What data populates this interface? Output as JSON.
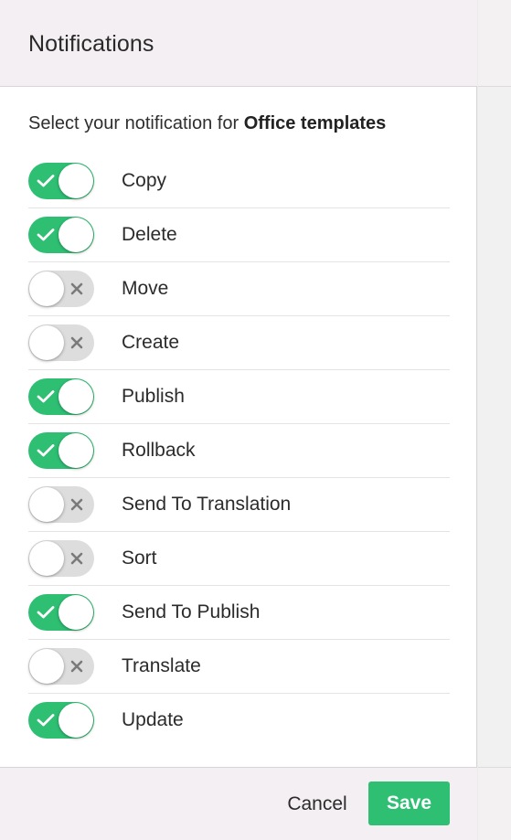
{
  "dialog": {
    "title": "Notifications",
    "subtitle_prefix": "Select your notification for ",
    "subtitle_target": "Office templates"
  },
  "options": [
    {
      "label": "Copy",
      "enabled": true
    },
    {
      "label": "Delete",
      "enabled": true
    },
    {
      "label": "Move",
      "enabled": false
    },
    {
      "label": "Create",
      "enabled": false
    },
    {
      "label": "Publish",
      "enabled": true
    },
    {
      "label": "Rollback",
      "enabled": true
    },
    {
      "label": "Send To Translation",
      "enabled": false
    },
    {
      "label": "Sort",
      "enabled": false
    },
    {
      "label": "Send To Publish",
      "enabled": true
    },
    {
      "label": "Translate",
      "enabled": false
    },
    {
      "label": "Update",
      "enabled": true
    }
  ],
  "footer": {
    "cancel_label": "Cancel",
    "save_label": "Save"
  },
  "icons": {
    "on": "check-icon",
    "off": "x-icon"
  },
  "colors": {
    "accent": "#2ebf73",
    "toggle_off": "#dddddd",
    "header_bg": "#f4eff2"
  }
}
